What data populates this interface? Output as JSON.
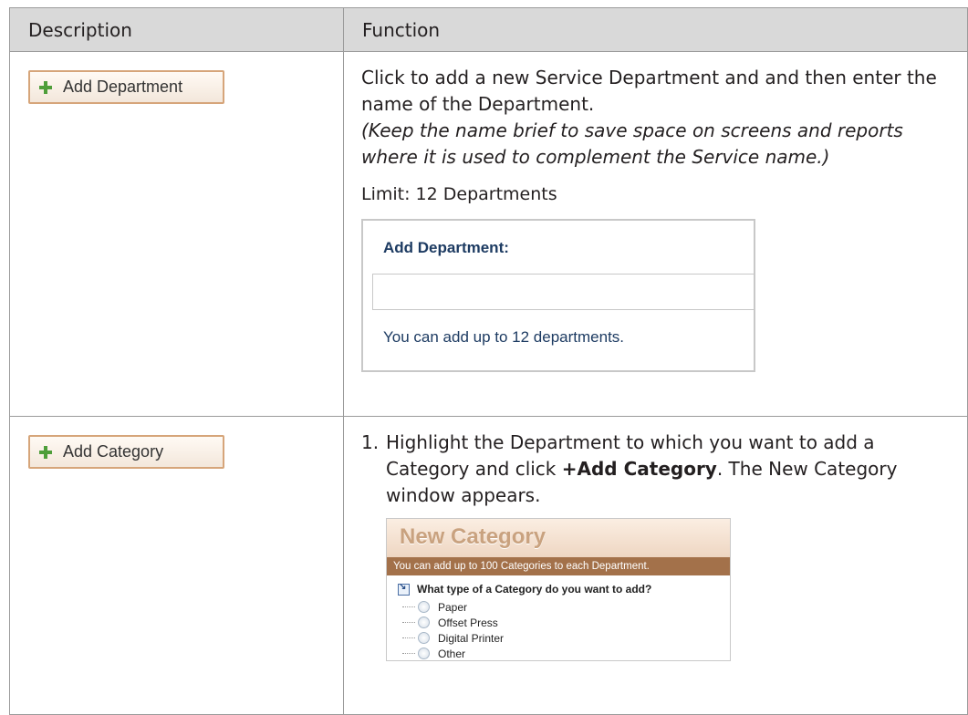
{
  "table": {
    "headers": [
      "Description",
      "Function"
    ]
  },
  "row1": {
    "button_label": "Add Department",
    "desc": "Click to add a new Service Department and and then enter the name of the Department.",
    "note": "(Keep the name brief to save space on screens and reports where it is used to complement the Service name.)",
    "limit": "Limit: 12 Departments",
    "panel": {
      "title": "Add Department:",
      "hint": "You can add up to 12 departments."
    }
  },
  "row2": {
    "button_label": "Add Category",
    "step_num": "1.",
    "step_pre": "Highlight the Department to which you want to add a Category and click ",
    "step_bold": "+Add Category",
    "step_post": ". The New Category window appears.",
    "window": {
      "title": "New Category",
      "banner": "You can add up to 100 Categories to each Department.",
      "question": "What type of a Category do you want to add?",
      "options": [
        "Paper",
        "Offset Press",
        "Digital Printer",
        "Other"
      ]
    }
  },
  "colors": {
    "header_bg": "#d9d9d9",
    "button_border": "#d6a57a",
    "panel_text": "#1d3b62",
    "banner_bg": "#a3714a"
  }
}
